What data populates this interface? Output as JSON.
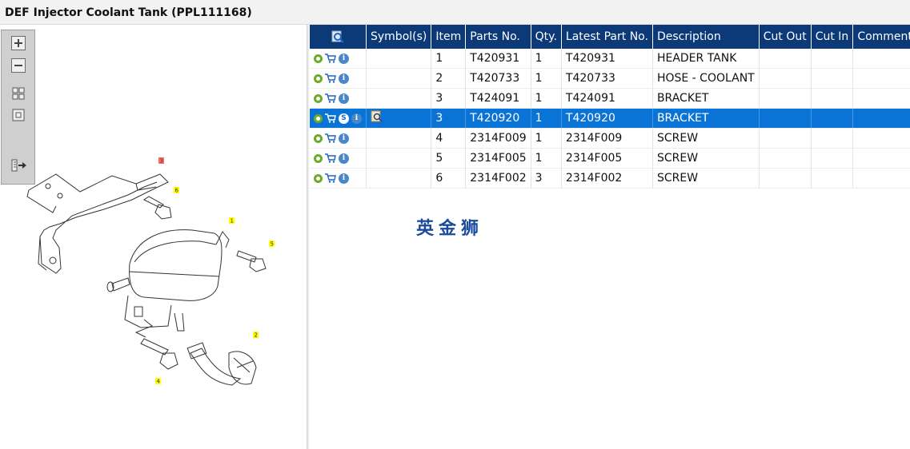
{
  "window": {
    "title": "DEF Injector Coolant Tank (PPL111168)"
  },
  "toolbar": {
    "buttons": [
      "zoom-in",
      "zoom-out",
      "fit-grid",
      "actual-size",
      "export"
    ]
  },
  "table": {
    "headers": {
      "find": "find-icon",
      "symbols": "Symbol(s)",
      "item": "Item",
      "parts_no": "Parts No.",
      "qty": "Qty.",
      "latest": "Latest Part No.",
      "description": "Description",
      "cut_out": "Cut Out",
      "cut_in": "Cut In",
      "comment": "Comment"
    },
    "rows": [
      {
        "item": "1",
        "parts_no": "T420931",
        "qty": "1",
        "latest": "T420931",
        "description": "HEADER TANK",
        "cut_out": "",
        "cut_in": "",
        "comment": "",
        "selected": false
      },
      {
        "item": "2",
        "parts_no": "T420733",
        "qty": "1",
        "latest": "T420733",
        "description": "HOSE - COOLANT",
        "cut_out": "",
        "cut_in": "",
        "comment": "",
        "selected": false
      },
      {
        "item": "3",
        "parts_no": "T424091",
        "qty": "1",
        "latest": "T424091",
        "description": "BRACKET",
        "cut_out": "",
        "cut_in": "",
        "comment": "",
        "selected": false
      },
      {
        "item": "3",
        "parts_no": "T420920",
        "qty": "1",
        "latest": "T420920",
        "description": "BRACKET",
        "cut_out": "",
        "cut_in": "",
        "comment": "",
        "selected": true
      },
      {
        "item": "4",
        "parts_no": "2314F009",
        "qty": "1",
        "latest": "2314F009",
        "description": "SCREW",
        "cut_out": "",
        "cut_in": "",
        "comment": "",
        "selected": false
      },
      {
        "item": "5",
        "parts_no": "2314F005",
        "qty": "1",
        "latest": "2314F005",
        "description": "SCREW",
        "cut_out": "",
        "cut_in": "",
        "comment": "",
        "selected": false
      },
      {
        "item": "6",
        "parts_no": "2314F002",
        "qty": "3",
        "latest": "2314F002",
        "description": "SCREW",
        "cut_out": "",
        "cut_in": "",
        "comment": "",
        "selected": false
      }
    ],
    "selected_badge": "S",
    "info_glyph": "i"
  },
  "diagram": {
    "callouts": [
      "3",
      "6",
      "1",
      "5",
      "2",
      "4"
    ]
  },
  "watermark": {
    "text": "英金狮"
  },
  "colors": {
    "header_bg": "#0c3a78",
    "selected_row": "#0a74d6",
    "callout_yellow": "#ffff00",
    "callout_red": "#ff6b6b"
  }
}
